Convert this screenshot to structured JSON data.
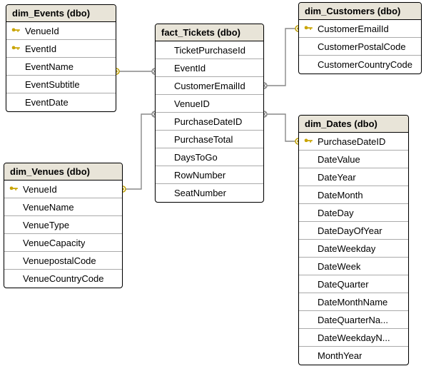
{
  "tables": {
    "events": {
      "title": "dim_Events (dbo)",
      "columns": [
        {
          "name": "VenueId",
          "key": true
        },
        {
          "name": "EventId",
          "key": true
        },
        {
          "name": "EventName",
          "key": false
        },
        {
          "name": "EventSubtitle",
          "key": false
        },
        {
          "name": "EventDate",
          "key": false
        }
      ]
    },
    "tickets": {
      "title": "fact_Tickets (dbo)",
      "columns": [
        {
          "name": "TicketPurchaseId",
          "key": false
        },
        {
          "name": "EventId",
          "key": false
        },
        {
          "name": "CustomerEmailId",
          "key": false
        },
        {
          "name": "VenueID",
          "key": false
        },
        {
          "name": "PurchaseDateID",
          "key": false
        },
        {
          "name": "PurchaseTotal",
          "key": false
        },
        {
          "name": "DaysToGo",
          "key": false
        },
        {
          "name": "RowNumber",
          "key": false
        },
        {
          "name": "SeatNumber",
          "key": false
        }
      ]
    },
    "customers": {
      "title": "dim_Customers (dbo)",
      "columns": [
        {
          "name": "CustomerEmailId",
          "key": true
        },
        {
          "name": "CustomerPostalCode",
          "key": false
        },
        {
          "name": "CustomerCountryCode",
          "key": false
        }
      ]
    },
    "venues": {
      "title": "dim_Venues (dbo)",
      "columns": [
        {
          "name": "VenueId",
          "key": true
        },
        {
          "name": "VenueName",
          "key": false
        },
        {
          "name": "VenueType",
          "key": false
        },
        {
          "name": "VenueCapacity",
          "key": false
        },
        {
          "name": "VenuepostalCode",
          "key": false
        },
        {
          "name": "VenueCountryCode",
          "key": false
        }
      ]
    },
    "dates": {
      "title": "dim_Dates (dbo)",
      "columns": [
        {
          "name": "PurchaseDateID",
          "key": true
        },
        {
          "name": "DateValue",
          "key": false
        },
        {
          "name": "DateYear",
          "key": false
        },
        {
          "name": "DateMonth",
          "key": false
        },
        {
          "name": "DateDay",
          "key": false
        },
        {
          "name": "DateDayOfYear",
          "key": false
        },
        {
          "name": "DateWeekday",
          "key": false
        },
        {
          "name": "DateWeek",
          "key": false
        },
        {
          "name": "DateQuarter",
          "key": false
        },
        {
          "name": "DateMonthName",
          "key": false
        },
        {
          "name": "DateQuarterNa...",
          "key": false
        },
        {
          "name": "DateWeekdayN...",
          "key": false
        },
        {
          "name": "MonthYear",
          "key": false
        }
      ]
    }
  },
  "chart_data": {
    "type": "table",
    "relationships": [
      {
        "from": "fact_Tickets.EventId",
        "to": "dim_Events.EventId"
      },
      {
        "from": "fact_Tickets.VenueID",
        "to": "dim_Venues.VenueId"
      },
      {
        "from": "fact_Tickets.CustomerEmailId",
        "to": "dim_Customers.CustomerEmailId"
      },
      {
        "from": "fact_Tickets.PurchaseDateID",
        "to": "dim_Dates.PurchaseDateID"
      }
    ]
  }
}
